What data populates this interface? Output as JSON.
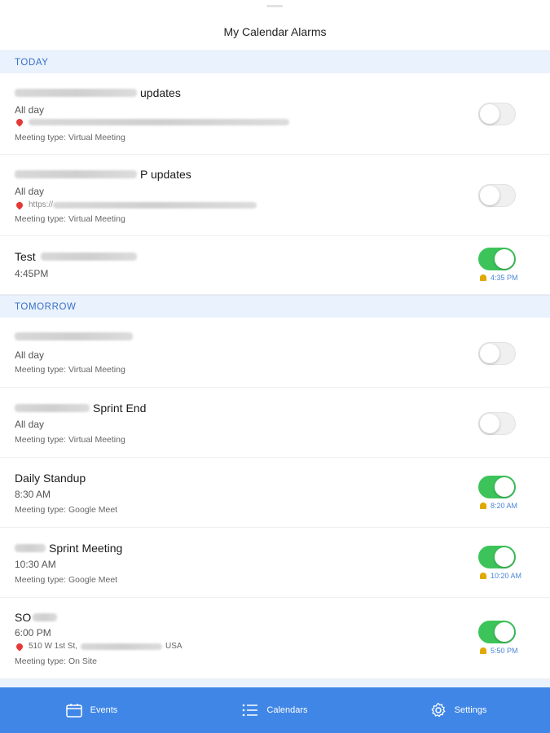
{
  "header": {
    "title": "My Calendar Alarms"
  },
  "sections": {
    "today": "TODAY",
    "tomorrow": "TOMORROW"
  },
  "events": [
    {
      "title_suffix": "updates",
      "time": "All day",
      "location": "",
      "meeting_type": "Meeting type: Virtual Meeting",
      "alarm_on": false,
      "alarm_time": ""
    },
    {
      "title_suffix": "P updates",
      "time": "All day",
      "location": "https://",
      "meeting_type": "Meeting type: Virtual Meeting",
      "alarm_on": false,
      "alarm_time": ""
    },
    {
      "title_prefix": "Test",
      "time": "4:45PM",
      "alarm_on": true,
      "alarm_time": "4:35 PM"
    },
    {
      "time": "All day",
      "meeting_type": "Meeting type: Virtual Meeting",
      "alarm_on": false,
      "alarm_time": ""
    },
    {
      "title_suffix": "Sprint End",
      "time": "All day",
      "meeting_type": "Meeting type: Virtual Meeting",
      "alarm_on": false,
      "alarm_time": ""
    },
    {
      "title": "Daily Standup",
      "time": "8:30 AM",
      "meeting_type": "Meeting type: Google Meet",
      "alarm_on": true,
      "alarm_time": "8:20 AM"
    },
    {
      "title_suffix": "Sprint Meeting",
      "time": "10:30 AM",
      "meeting_type": "Meeting type: Google Meet",
      "alarm_on": true,
      "alarm_time": "10:20 AM"
    },
    {
      "title_prefix": "SO",
      "time": "6:00 PM",
      "location": "510 W 1st St,",
      "location_end": "USA",
      "meeting_type": "Meeting type: On Site",
      "alarm_on": true,
      "alarm_time": "5:50 PM"
    }
  ],
  "tabs": [
    {
      "label": "Events",
      "icon": "calendar-icon"
    },
    {
      "label": "Calendars",
      "icon": "list-icon"
    },
    {
      "label": "Settings",
      "icon": "gear-icon"
    }
  ],
  "colors": {
    "accent": "#3f86e6",
    "toggle_on": "#3cc45a",
    "section_bg": "#e9f2fd",
    "section_text": "#3a6fc8"
  }
}
